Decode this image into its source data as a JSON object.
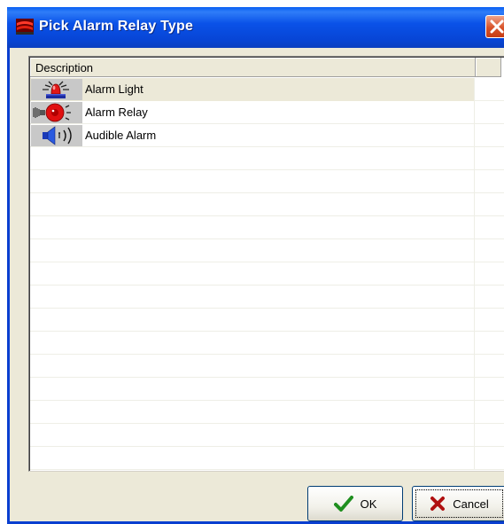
{
  "window": {
    "title": "Pick Alarm Relay Type"
  },
  "grid": {
    "columns": [
      "Description",
      ""
    ],
    "rows": [
      {
        "icon": "alarm-light-icon",
        "label": "Alarm Light",
        "selected": true
      },
      {
        "icon": "alarm-relay-icon",
        "label": "Alarm Relay",
        "selected": false
      },
      {
        "icon": "audible-alarm-icon",
        "label": "Audible Alarm",
        "selected": false
      }
    ],
    "empty_rows": 14
  },
  "buttons": {
    "ok_label": "OK",
    "cancel_label": "Cancel"
  },
  "colors": {
    "titlebar": "#0a52e8",
    "close": "#d8532a",
    "ok_check": "#1f8f1f",
    "cancel_x": "#b01010"
  }
}
